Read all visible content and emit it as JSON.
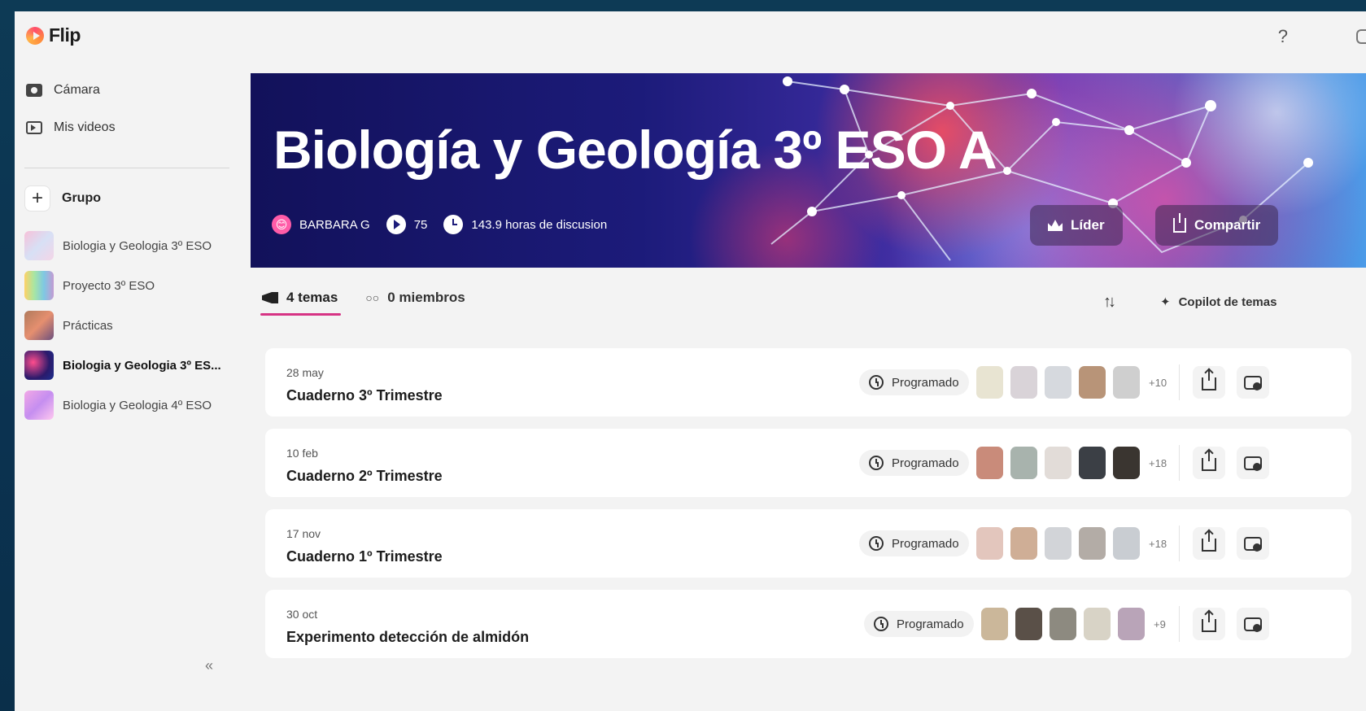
{
  "app": {
    "name": "Flip",
    "help_label": "?"
  },
  "sidebar": {
    "nav": [
      {
        "label": "Cámara",
        "icon": "camera-icon"
      },
      {
        "label": "Mis videos",
        "icon": "video-icon"
      }
    ],
    "add_group_label": "Grupo",
    "groups": [
      {
        "name": "Biologia y Geologia 3º ESO",
        "active": false
      },
      {
        "name": "Proyecto 3º ESO",
        "active": false
      },
      {
        "name": "Prácticas",
        "active": false
      },
      {
        "name": "Biologia y Geologia 3º ES...",
        "active": true
      },
      {
        "name": "Biologia y Geologia 4º ESO",
        "active": false
      }
    ],
    "collapse_label": "«"
  },
  "banner": {
    "title": "Biología y Geología 3º ESO A",
    "owner": "BARBARA G",
    "owner_emoji": "😊",
    "video_count": "75",
    "discussion_hours": "143.9 horas de discusion",
    "lead_button": "Líder",
    "share_button": "Compartir"
  },
  "tabs": {
    "topics": "4 temas",
    "members": "0 miembros",
    "members_icon": "people-icon",
    "sort_label": "↑↓",
    "copilot": "Copilot de temas"
  },
  "topics": [
    {
      "date": "28 may",
      "title": "Cuaderno 3º Trimestre",
      "status": "Programado",
      "more": "+10",
      "thumb_colors": [
        "#e8e4d2",
        "#d9d3d8",
        "#d6d9de",
        "#b89478",
        "#cfcfcf"
      ]
    },
    {
      "date": "10 feb",
      "title": "Cuaderno 2º Trimestre",
      "status": "Programado",
      "more": "+18",
      "thumb_colors": [
        "#c98b7a",
        "#a8b3ad",
        "#e2dcd8",
        "#3b3f45",
        "#3a3530"
      ]
    },
    {
      "date": "17 nov",
      "title": "Cuaderno 1º Trimestre",
      "status": "Programado",
      "more": "+18",
      "thumb_colors": [
        "#e3c6bd",
        "#cfae96",
        "#d2d4d8",
        "#b3aca6",
        "#c9cdd2"
      ]
    },
    {
      "date": "30 oct",
      "title": "Experimento detección de almidón",
      "status": "Programado",
      "more": "+9",
      "thumb_colors": [
        "#cbb79a",
        "#5a5048",
        "#8d8a80",
        "#d8d3c6",
        "#b9a4b8"
      ]
    }
  ]
}
